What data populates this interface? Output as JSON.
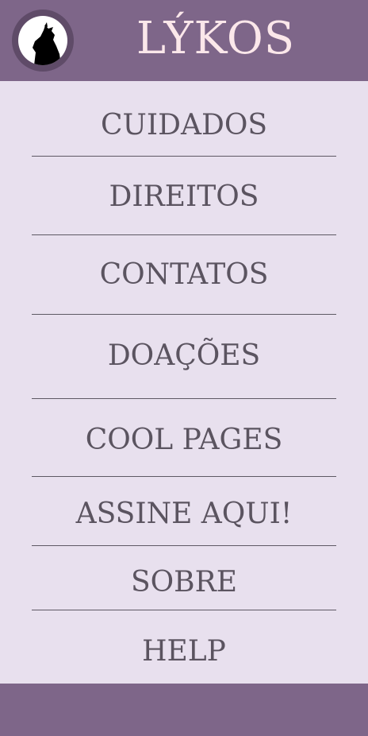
{
  "header": {
    "title": "LÝKOS",
    "logo_icon": "howling-wolf-icon",
    "colors": {
      "bar": "#7e6689",
      "title": "#fbe7ea"
    }
  },
  "menu": {
    "items": [
      {
        "label": "CUIDADOS"
      },
      {
        "label": "DIREITOS"
      },
      {
        "label": "CONTATOS"
      },
      {
        "label": "DOAÇÕES"
      },
      {
        "label": "COOL PAGES"
      },
      {
        "label": "ASSINE AQUI!"
      },
      {
        "label": "SOBRE"
      },
      {
        "label": "HELP"
      }
    ],
    "colors": {
      "background": "#e8e0ee",
      "text": "#5b5460",
      "separator": "#5e5964"
    }
  }
}
